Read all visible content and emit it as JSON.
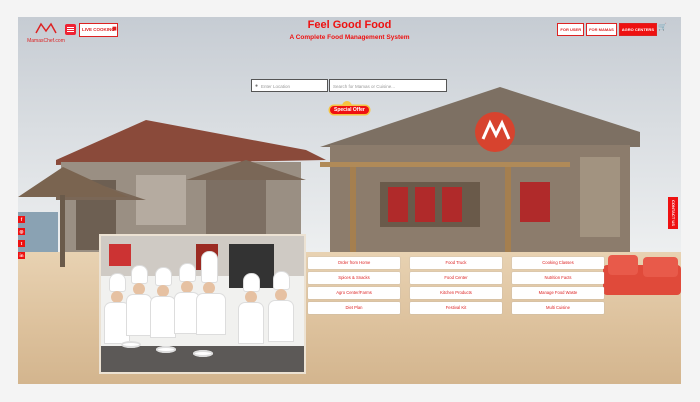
{
  "header": {
    "logo_text": "MamasChef.com",
    "live_cooking": "LIVE COOKING",
    "title": "Feel Good Food",
    "subtitle": "A Complete Food Management System",
    "right_buttons": [
      "FOR USER",
      "FOR MAMAS",
      "AGRO CENTERS"
    ]
  },
  "search": {
    "location_placeholder": "Enter Location",
    "query_placeholder": "Search for Mamas or Cuisine..."
  },
  "special_offer": "Special Offer",
  "social": [
    "f",
    "◎",
    "t",
    "in"
  ],
  "contact_tab": "CONTACT US",
  "services": [
    "Order from Home",
    "Food Truck",
    "Cooking Classes",
    "Spices & Snacks",
    "Food Center",
    "Nutrition Facts",
    "Agro Center/Farms",
    "Kitchen Products",
    "Manage Food Waste",
    "Diet Plan",
    "Festival Kit",
    "Multi Cuisine"
  ],
  "colors": {
    "accent": "#e11a1a",
    "sand": "#dcc09b"
  },
  "icons": [
    "menu-icon",
    "apple-icon",
    "android-icon",
    "cart-icon",
    "location-pin-icon"
  ]
}
